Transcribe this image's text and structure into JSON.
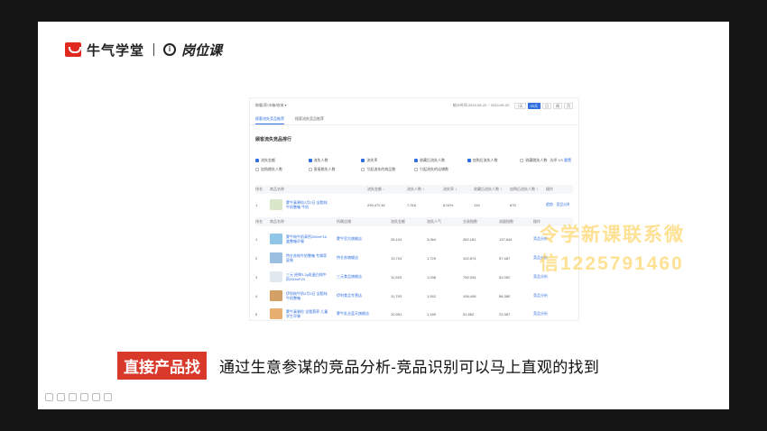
{
  "logo": {
    "brand": "牛气学堂",
    "circle": "i",
    "product": "岗位课"
  },
  "shot": {
    "breadcrumb": "取暖/家/冰箱/收纳 ▾",
    "date_range": "统计时间 2019-08-22 ~ 2019-09-20",
    "periods": [
      "7天",
      "30天",
      "日",
      "周",
      "月"
    ],
    "active_period": "30天",
    "tabs": [
      "顾客流失竞品推荐",
      "搜索流失竞品推荐"
    ],
    "section_title": "顾客流失竞品排行",
    "checks": [
      {
        "label": "流失金额",
        "on": true
      },
      {
        "label": "流失人数",
        "on": true
      },
      {
        "label": "流失率",
        "on": true
      },
      {
        "label": "收藏后流失人数",
        "on": true
      },
      {
        "label": "加购后流失人数",
        "on": true
      },
      {
        "label": "收藏跳失人数",
        "on": false
      },
      {
        "label": "加购跳失人数",
        "on": false
      },
      {
        "label": "直接跳失人数",
        "on": false
      },
      {
        "label": "引起流失的商品数",
        "on": false
      },
      {
        "label": "引起流失的店铺数",
        "on": false
      }
    ],
    "checks_summary": "选择 5/5",
    "checks_reset": "重置",
    "head1": [
      "排名",
      "商品名称",
      "流失金额 ↓",
      "流失人数 ↕",
      "流失率 ↕",
      "收藏后流失人数 ↕",
      "加购后流失人数 ↕",
      "操作"
    ],
    "row1": {
      "rank": "1",
      "name": "蒙牛真果粒2月2日 全脂纯牛奶整箱 牛奶",
      "amount": "299,472.61",
      "lost": "7,316",
      "rate": "6.02%",
      "fav": "134",
      "cart": "875",
      "ops": "趋势 · 竞品分析"
    },
    "head2": [
      "排名",
      "商品名称",
      "所属店铺",
      "流失金额",
      "流失人气",
      "交易指数",
      "流量指数",
      "操作"
    ],
    "rows": [
      {
        "rank": "1",
        "name": "蒙牛纯牛奶高钙250ml*16盒整箱早餐",
        "shop": "蒙牛官方旗舰店",
        "amount": "28,104",
        "pop": "3,064",
        "trade": "282,181",
        "flow": "137,844",
        "op": "竞品分析"
      },
      {
        "rank": "2",
        "name": "特仑苏纯牛奶整箱 专属家庭装",
        "shop": "特仑苏旗舰店",
        "amount": "13,724",
        "pop": "1,729",
        "trade": "102,874",
        "flow": "57,487",
        "op": "竞品分析"
      },
      {
        "rank": "3",
        "name": "三元 经典3.2g乳蛋白纯牛奶250ml*24",
        "shop": "三元食品旗舰店",
        "amount": "11,943",
        "pop": "1,038",
        "trade": "790,034",
        "flow": "52,052",
        "op": "竞品分析"
      },
      {
        "rank": "4",
        "name": "伊利纯牛奶2月3日 全脂纯牛奶整箱",
        "shop": "伊利食品专营店",
        "amount": "11,793",
        "pop": "1,542",
        "trade": "106,408",
        "flow": "58,380",
        "op": "竞品分析"
      },
      {
        "rank": "5",
        "name": "蒙牛真果粒 全脂营养 儿童学生早餐",
        "shop": "蒙牛乳业蓝天旗舰店",
        "amount": "10,951",
        "pop": "1,185",
        "trade": "51,862",
        "flow": "23,387",
        "op": "竞品分析"
      }
    ]
  },
  "caption": {
    "tag": "直接产品找",
    "text": "通过生意参谋的竞品分析-竞品识别可以马上直观的找到"
  },
  "watermark": {
    "line1": "令学新课联系微",
    "line2": "信1225791460"
  },
  "colors": {
    "accent": "#2f6fe0",
    "brand_red": "#e02a1f",
    "caption_red": "#d8392b"
  }
}
